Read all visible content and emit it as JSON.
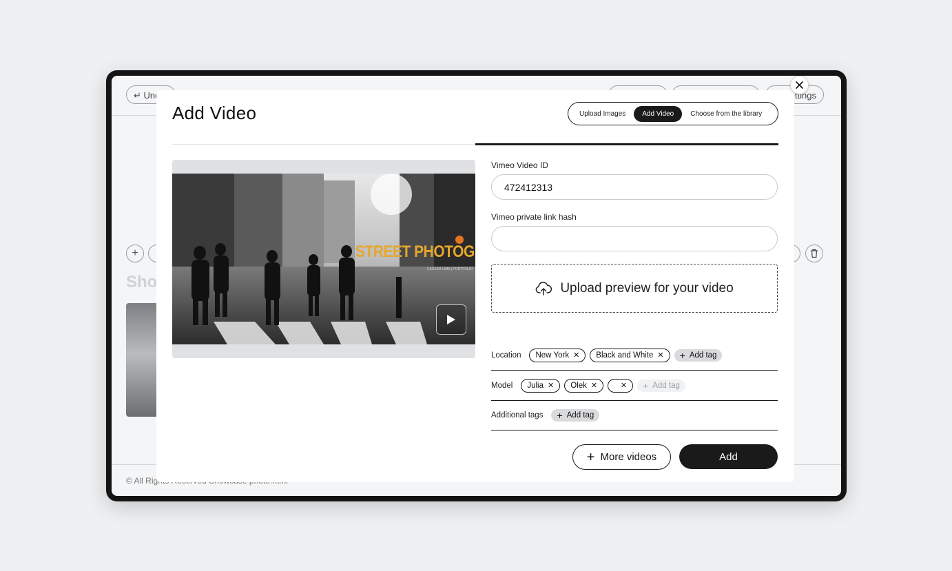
{
  "background_app": {
    "undo_label": "Undo",
    "settings_label": "Settings",
    "heading": "Sho",
    "copyright": "© All Rights Reserved Showcase photo.html"
  },
  "modal": {
    "title": "Add Video",
    "tabs": [
      {
        "label": "Upload Images",
        "active": false
      },
      {
        "label": "Add Video",
        "active": true
      },
      {
        "label": "Choose from the library",
        "active": false
      }
    ],
    "preview": {
      "overlay_title": "STREET PHOTOGRAPHY",
      "overlay_subtitle": "CAESAR LIMA | PORTFOLIO"
    },
    "vimeo_id": {
      "label": "Vimeo Video ID",
      "value": "472412313"
    },
    "private_hash": {
      "label": "Vimeo private link hash",
      "value": ""
    },
    "upload_preview_label": "Upload preview for your video",
    "tag_rows": {
      "location": {
        "label": "Location",
        "tags": [
          "New York",
          "Black and White"
        ],
        "add_label": "Add tag"
      },
      "model": {
        "label": "Model",
        "tags": [
          "Julia",
          "Olek",
          ""
        ],
        "add_label": "Add tag"
      },
      "additional": {
        "label": "Additional tags",
        "tags": [],
        "add_label": "Add tag"
      }
    },
    "more_videos_label": "More videos",
    "add_label": "Add"
  },
  "colors": {
    "primary": "#1a1a1a",
    "background": "#eef0f2",
    "accent_title": "#e6a72c"
  }
}
